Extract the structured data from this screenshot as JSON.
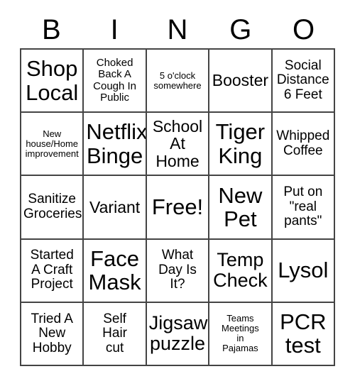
{
  "card": {
    "title": "BINGO Card",
    "header": {
      "letters": [
        "B",
        "I",
        "N",
        "G",
        "O"
      ]
    },
    "grid": {
      "columns": 5,
      "rows": 5,
      "border_color": "#444444",
      "background_color": "#ffffff",
      "text_color": "#000000",
      "cells": [
        {
          "text": "Shop\nLocal",
          "size": "sz-xxl",
          "column": "B",
          "row": 1,
          "free": false
        },
        {
          "text": "Choked\nBack A\nCough In\nPublic",
          "size": "sz-s",
          "column": "I",
          "row": 1,
          "free": false
        },
        {
          "text": "5 o'clock\nsomewhere",
          "size": "sz-xs",
          "column": "N",
          "row": 1,
          "free": false
        },
        {
          "text": "Booster",
          "size": "sz-l",
          "column": "G",
          "row": 1,
          "free": false
        },
        {
          "text": "Social\nDistance\n6 Feet",
          "size": "sz-m",
          "column": "O",
          "row": 1,
          "free": false
        },
        {
          "text": "New\nhouse/Home\nimprovement",
          "size": "sz-xs",
          "column": "B",
          "row": 2,
          "free": false
        },
        {
          "text": "Netflix\nBinge",
          "size": "sz-xxl",
          "column": "I",
          "row": 2,
          "free": false
        },
        {
          "text": "School\nAt\nHome",
          "size": "sz-l",
          "column": "N",
          "row": 2,
          "free": false
        },
        {
          "text": "Tiger\nKing",
          "size": "sz-xxl",
          "column": "G",
          "row": 2,
          "free": false
        },
        {
          "text": "Whipped\nCoffee",
          "size": "sz-m",
          "column": "O",
          "row": 2,
          "free": false
        },
        {
          "text": "Sanitize\nGroceries",
          "size": "sz-m",
          "column": "B",
          "row": 3,
          "free": false
        },
        {
          "text": "Variant",
          "size": "sz-l",
          "column": "I",
          "row": 3,
          "free": false
        },
        {
          "text": "Free!",
          "size": "sz-xxl",
          "column": "N",
          "row": 3,
          "free": true
        },
        {
          "text": "New\nPet",
          "size": "sz-xxl",
          "column": "G",
          "row": 3,
          "free": false
        },
        {
          "text": "Put on\n\"real\npants\"",
          "size": "sz-m",
          "column": "O",
          "row": 3,
          "free": false
        },
        {
          "text": "Started\nA Craft\nProject",
          "size": "sz-m",
          "column": "B",
          "row": 4,
          "free": false
        },
        {
          "text": "Face\nMask",
          "size": "sz-xxl",
          "column": "I",
          "row": 4,
          "free": false
        },
        {
          "text": "What\nDay Is\nIt?",
          "size": "sz-m",
          "column": "N",
          "row": 4,
          "free": false
        },
        {
          "text": "Temp\nCheck",
          "size": "sz-xl",
          "column": "G",
          "row": 4,
          "free": false
        },
        {
          "text": "Lysol",
          "size": "sz-xxl",
          "column": "O",
          "row": 4,
          "free": false
        },
        {
          "text": "Tried A\nNew\nHobby",
          "size": "sz-m",
          "column": "B",
          "row": 5,
          "free": false
        },
        {
          "text": "Self\nHair\ncut",
          "size": "sz-m",
          "column": "I",
          "row": 5,
          "free": false
        },
        {
          "text": "Jigsaw\npuzzle",
          "size": "sz-xl",
          "column": "N",
          "row": 5,
          "free": false
        },
        {
          "text": "Teams\nMeetings\nin\nPajamas",
          "size": "sz-xs",
          "column": "G",
          "row": 5,
          "free": false
        },
        {
          "text": "PCR\ntest",
          "size": "sz-xxl",
          "column": "O",
          "row": 5,
          "free": false
        }
      ]
    }
  }
}
